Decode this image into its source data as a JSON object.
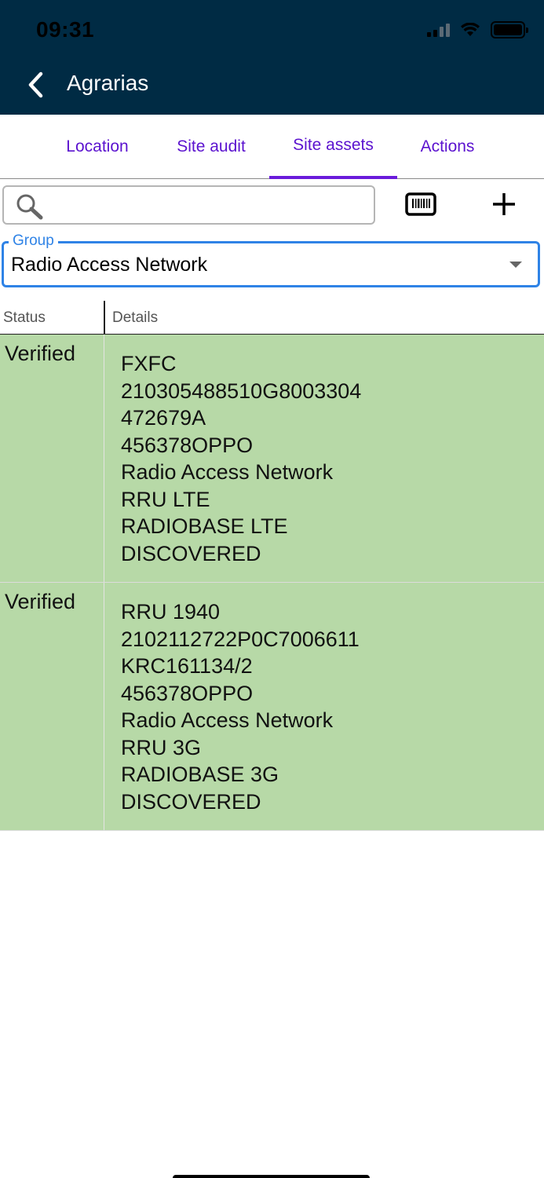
{
  "status_bar": {
    "time": "09:31"
  },
  "header": {
    "title": "Agrarias"
  },
  "tabs": [
    {
      "label": "Location",
      "active": false
    },
    {
      "label": "Site audit",
      "active": false
    },
    {
      "label": "Site assets",
      "active": true
    },
    {
      "label": "Actions",
      "active": false
    }
  ],
  "search": {
    "value": "",
    "placeholder": ""
  },
  "group": {
    "label": "Group",
    "value": "Radio Access Network"
  },
  "table": {
    "columns": [
      "Status",
      "Details"
    ],
    "rows": [
      {
        "status": "Verified",
        "details": [
          "FXFC",
          "210305488510G8003304",
          "472679A",
          "456378OPPO",
          "Radio Access Network",
          "RRU LTE",
          "RADIOBASE LTE",
          "DISCOVERED"
        ]
      },
      {
        "status": "Verified",
        "details": [
          "RRU 1940",
          "2102112722P0C7006611",
          "KRC161134/2",
          "456378OPPO",
          "Radio Access Network",
          "RRU 3G",
          "RADIOBASE 3G",
          "DISCOVERED"
        ]
      }
    ]
  },
  "colors": {
    "header_bg": "#002b44",
    "tab_text": "#5b12cf",
    "accent_blue": "#2f83e6",
    "verified_row_bg": "#b7d9a7"
  },
  "icons": [
    "back-chevron-icon",
    "search-icon",
    "barcode-scanner-icon",
    "plus-icon"
  ]
}
